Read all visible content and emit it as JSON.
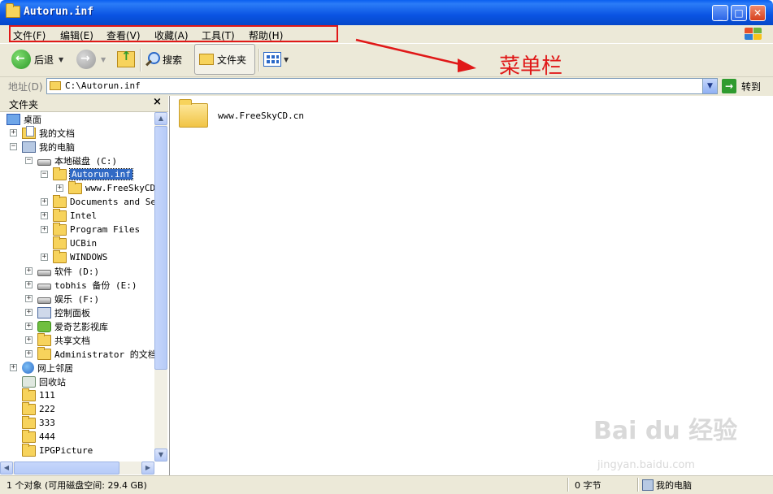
{
  "window": {
    "title": "Autorun.inf"
  },
  "menu": [
    "文件(F)",
    "编辑(E)",
    "查看(V)",
    "收藏(A)",
    "工具(T)",
    "帮助(H)"
  ],
  "annotation": {
    "label": "菜单栏"
  },
  "toolbar": {
    "back": "后退",
    "search": "搜索",
    "folders": "文件夹"
  },
  "address": {
    "label": "地址(D)",
    "value": "C:\\Autorun.inf",
    "go": "转到"
  },
  "folder_pane": {
    "title": "文件夹",
    "close": "×",
    "tree": [
      {
        "label": "桌面",
        "icon": "desktop-icon"
      },
      {
        "label": "我的文档",
        "icon": "my-documents-icon"
      },
      {
        "label": "我的电脑",
        "icon": "my-computer-icon"
      },
      {
        "label": "本地磁盘 (C:)",
        "icon": "drive-icon"
      },
      {
        "label": "Autorun.inf",
        "icon": "folder-icon"
      },
      {
        "label": "www.FreeSkyCD.",
        "icon": "folder-icon"
      },
      {
        "label": "Documents and Set",
        "icon": "folder-icon"
      },
      {
        "label": "Intel",
        "icon": "folder-icon"
      },
      {
        "label": "Program Files",
        "icon": "folder-icon"
      },
      {
        "label": "UCBin",
        "icon": "folder-icon"
      },
      {
        "label": "WINDOWS",
        "icon": "folder-icon"
      },
      {
        "label": "软件 (D:)",
        "icon": "drive-icon"
      },
      {
        "label": "tobhis 备份 (E:)",
        "icon": "drive-icon"
      },
      {
        "label": "娱乐 (F:)",
        "icon": "drive-icon"
      },
      {
        "label": "控制面板",
        "icon": "control-panel-icon"
      },
      {
        "label": "爱奇艺影视库",
        "icon": "iqiyi-icon"
      },
      {
        "label": "共享文档",
        "icon": "folder-icon"
      },
      {
        "label": "Administrator 的文档",
        "icon": "folder-icon"
      },
      {
        "label": "网上邻居",
        "icon": "network-icon"
      },
      {
        "label": "回收站",
        "icon": "recycle-bin-icon"
      },
      {
        "label": "111",
        "icon": "folder-icon"
      },
      {
        "label": "222",
        "icon": "folder-icon"
      },
      {
        "label": "333",
        "icon": "folder-icon"
      },
      {
        "label": "444",
        "icon": "folder-icon"
      },
      {
        "label": "IPGPicture",
        "icon": "folder-icon"
      }
    ]
  },
  "content": {
    "items": [
      {
        "label": "www.FreeSkyCD.cn",
        "icon": "folder-icon"
      }
    ]
  },
  "watermark": {
    "line1": "Bai du 经验",
    "line2": "jingyan.baidu.com"
  },
  "status": {
    "objects": "1 个对象 (可用磁盘空间: 29.4 GB)",
    "size": "0 字节",
    "location": "我的电脑"
  },
  "colors": {
    "titlebar": "#0a54e3",
    "annotation": "#e01818",
    "selection": "#316ac5",
    "chrome": "#ece9d8"
  }
}
